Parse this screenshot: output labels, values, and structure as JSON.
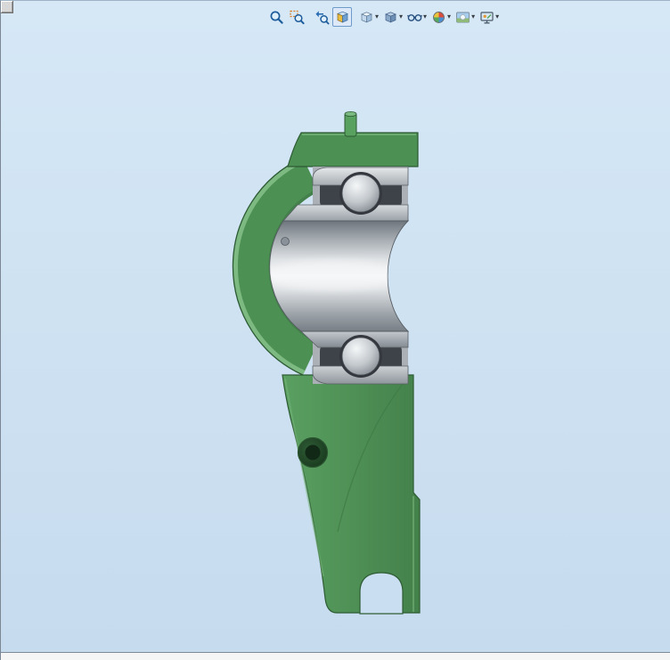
{
  "window": {
    "kind": "cad-viewport"
  },
  "toolbar": {
    "caret_glyph": "▾",
    "items": [
      {
        "id": "zoom-to-fit",
        "icon": "magnifier",
        "dropdown": false,
        "active": false
      },
      {
        "id": "zoom-to-area",
        "icon": "magnifier-area",
        "dropdown": false,
        "active": false
      },
      {
        "id": "previous-view",
        "icon": "back-arrow-lens",
        "dropdown": false,
        "active": false
      },
      {
        "id": "section-view",
        "icon": "section-cube",
        "dropdown": false,
        "active": true
      },
      {
        "id": "view-orientation",
        "icon": "orientation-cube",
        "dropdown": true,
        "active": false
      },
      {
        "id": "display-style",
        "icon": "shaded-cube",
        "dropdown": true,
        "active": false
      },
      {
        "id": "hide-show-items",
        "icon": "glasses",
        "dropdown": true,
        "active": false
      },
      {
        "id": "edit-appearance",
        "icon": "color-ball",
        "dropdown": true,
        "active": false
      },
      {
        "id": "apply-scene",
        "icon": "scene-picture",
        "dropdown": true,
        "active": false
      },
      {
        "id": "view-settings",
        "icon": "monitor",
        "dropdown": true,
        "active": false
      }
    ]
  },
  "viewport": {
    "model": "pillow-block-bearing-section-view",
    "background_top": "#d6e8f6",
    "background_bottom": "#c6dbee"
  },
  "colors": {
    "housing_green": "#4d9054",
    "housing_green_light": "#82bf87",
    "housing_green_dark": "#2c5a33",
    "metal_light": "#eff1f2",
    "metal_mid": "#aab0b6",
    "metal_dark": "#3e434a",
    "active_button_border": "#6f9bcb",
    "statusbar_bg": "#f6f6f6"
  }
}
